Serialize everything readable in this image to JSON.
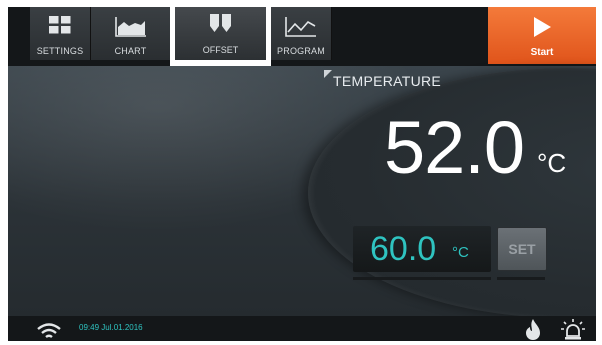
{
  "tabs": [
    {
      "label": "SETTINGS",
      "icon": "grid-icon",
      "selected": false
    },
    {
      "label": "CHART",
      "icon": "area-chart-icon",
      "selected": false
    },
    {
      "label": "OFFSET",
      "icon": "offset-icon",
      "selected": true
    },
    {
      "label": "PROGRAM",
      "icon": "line-chart-icon",
      "selected": false
    }
  ],
  "start": {
    "label": "Start",
    "icon": "play-icon",
    "color": "#e8601f"
  },
  "temperature": {
    "label": "TEMPERATURE",
    "value": "52.0",
    "unit": "°C"
  },
  "setpoint": {
    "value": "60.0",
    "unit": "°C",
    "button_label": "SET",
    "color": "#2fc3c0"
  },
  "status": {
    "time": "09:49",
    "date": "Jul.01.2016",
    "icons": [
      "wifi-icon",
      "flame-icon",
      "alarm-light-icon"
    ]
  }
}
